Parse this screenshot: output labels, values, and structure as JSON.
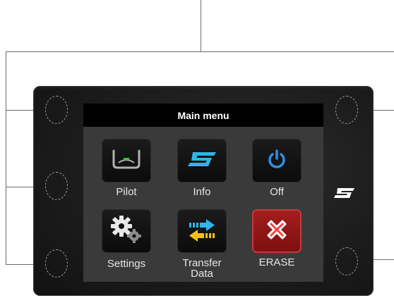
{
  "screen": {
    "title": "Main menu"
  },
  "menu_items": [
    {
      "label": "Pilot",
      "icon": "pilot-yoke-icon"
    },
    {
      "label": "Info",
      "icon": "brand-logo-icon"
    },
    {
      "label": "Off",
      "icon": "power-icon"
    },
    {
      "label": "Settings",
      "icon": "gears-icon"
    },
    {
      "label": "Transfer\nData",
      "icon": "transfer-arrows-icon"
    },
    {
      "label": "ERASE",
      "icon": "erase-x-icon"
    }
  ],
  "colors": {
    "accent_cyan": "#2fb6e8",
    "transfer_yellow": "#f2c21a",
    "erase_red": "#a51e1e",
    "power_blue": "#2f8fe3",
    "pilot_green": "#39c13a"
  }
}
